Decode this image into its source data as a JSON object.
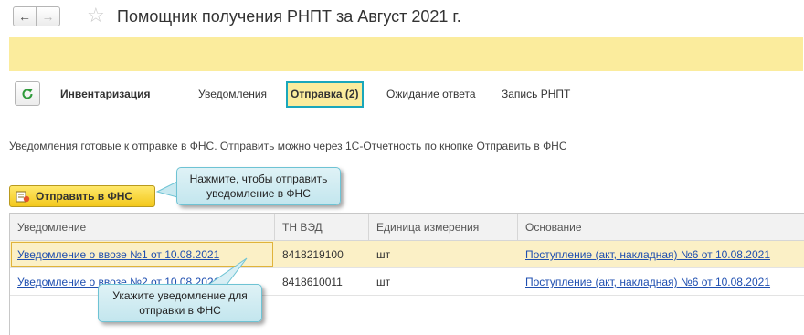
{
  "window": {
    "title": "Помощник получения РНПТ за Август 2021 г."
  },
  "tabs": [
    {
      "label": "Инвентаризация"
    },
    {
      "label": "Уведомления"
    },
    {
      "label": "Отправка (2)"
    },
    {
      "label": "Ожидание ответа"
    },
    {
      "label": "Запись РНПТ"
    }
  ],
  "info_text": "Уведомления готовые к отправке в ФНС. Отправить можно через 1С-Отчетность по кнопке Отправить в ФНС",
  "send_button": {
    "label": "Отправить в ФНС"
  },
  "table": {
    "columns": [
      "Уведомление",
      "ТН ВЭД",
      "Единица измерения",
      "Основание"
    ],
    "rows": [
      {
        "notice": "Уведомление о ввозе №1 от 10.08.2021",
        "tnved": "8418219100",
        "unit": "шт",
        "basis": "Поступление (акт, накладная) №6 от 10.08.2021"
      },
      {
        "notice": "Уведомление о ввозе №2 от 10.08.2021",
        "tnved": "8418610011",
        "unit": "шт",
        "basis": "Поступление (акт, накладная) №6 от 10.08.2021"
      }
    ]
  },
  "callouts": {
    "send": "Нажмите, чтобы отправить уведомление в ФНС",
    "select": "Укажите уведомление для отправки в ФНС"
  },
  "colors": {
    "banner": "#fbec9d",
    "active_tab_border": "#1aa7bb",
    "link": "#1f4fb0",
    "selected_row": "#fbf0c6",
    "send_button": "#f3c81c",
    "callout": "#c3e6ee"
  },
  "icons": [
    "arrow-left-icon",
    "arrow-right-icon",
    "star-icon",
    "refresh-icon",
    "send-document-icon"
  ]
}
